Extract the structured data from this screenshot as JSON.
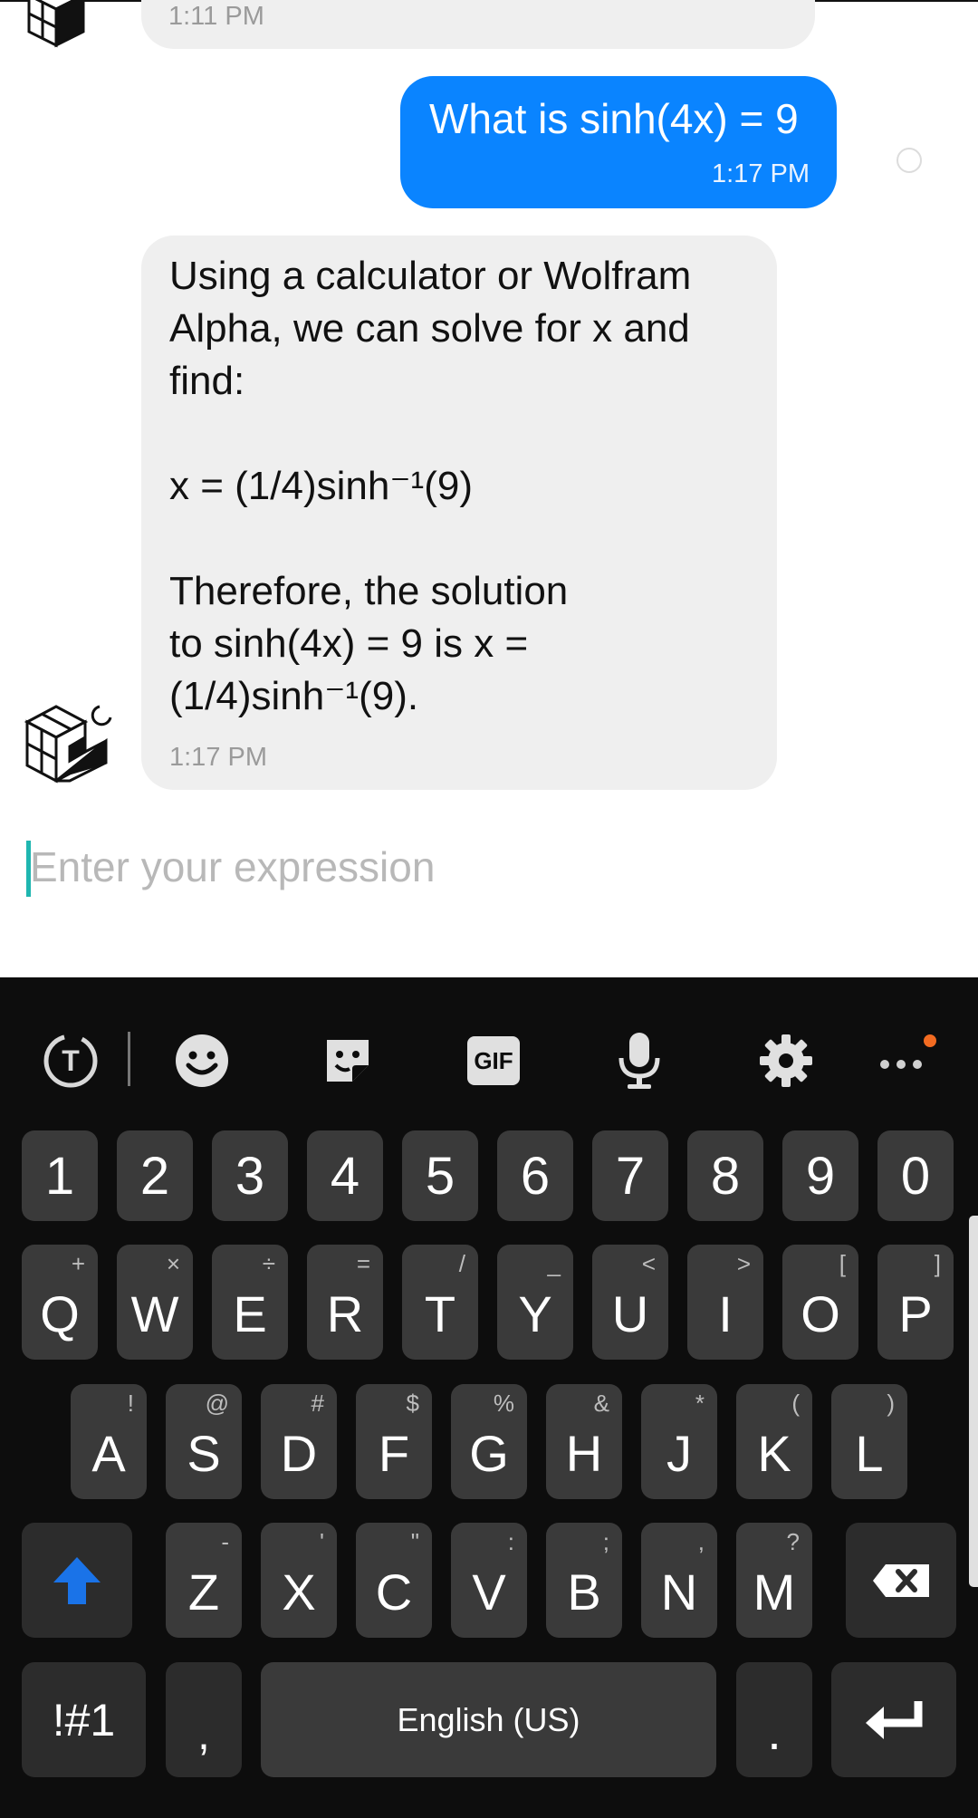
{
  "chat": {
    "prev_timestamp": "1:11 PM",
    "user_message": "What is sinh(4x) = 9",
    "user_timestamp": "1:17 PM",
    "bot_message": "Using a calculator or Wolfram\nAlpha, we can solve for x and\nfind:\n\nx = (1/4)sinh⁻¹(9)\n\nTherefore, the solution\nto sinh(4x) = 9 is x =\n(1/4)sinh⁻¹(9).",
    "bot_timestamp": "1:17 PM"
  },
  "input": {
    "placeholder": "Enter your expression"
  },
  "keyboard": {
    "toolbar": [
      "text-mode-icon",
      "emoji-icon",
      "sticker-icon",
      "gif-icon",
      "microphone-icon",
      "gear-icon",
      "more-icon"
    ],
    "gif_label": "GIF",
    "row_numbers": [
      "1",
      "2",
      "3",
      "4",
      "5",
      "6",
      "7",
      "8",
      "9",
      "0"
    ],
    "row_q": [
      {
        "k": "Q",
        "h": "+"
      },
      {
        "k": "W",
        "h": "×"
      },
      {
        "k": "E",
        "h": "÷"
      },
      {
        "k": "R",
        "h": "="
      },
      {
        "k": "T",
        "h": "/"
      },
      {
        "k": "Y",
        "h": "_"
      },
      {
        "k": "U",
        "h": "<"
      },
      {
        "k": "I",
        "h": ">"
      },
      {
        "k": "O",
        "h": "["
      },
      {
        "k": "P",
        "h": "]"
      }
    ],
    "row_a": [
      {
        "k": "A",
        "h": "!"
      },
      {
        "k": "S",
        "h": "@"
      },
      {
        "k": "D",
        "h": "#"
      },
      {
        "k": "F",
        "h": "$"
      },
      {
        "k": "G",
        "h": "%"
      },
      {
        "k": "H",
        "h": "&"
      },
      {
        "k": "J",
        "h": "*"
      },
      {
        "k": "K",
        "h": "("
      },
      {
        "k": "L",
        "h": ")"
      }
    ],
    "row_z": [
      {
        "k": "Z",
        "h": "-"
      },
      {
        "k": "X",
        "h": "'"
      },
      {
        "k": "C",
        "h": "\""
      },
      {
        "k": "V",
        "h": ":"
      },
      {
        "k": "B",
        "h": ";"
      },
      {
        "k": "N",
        "h": ","
      },
      {
        "k": "M",
        "h": "?"
      }
    ],
    "symbols_label": "!#1",
    "comma_label": ",",
    "space_label": "English (US)",
    "period_label": ".",
    "accent_color": "#1a73e8",
    "notification_dot_color": "#f26b21"
  }
}
